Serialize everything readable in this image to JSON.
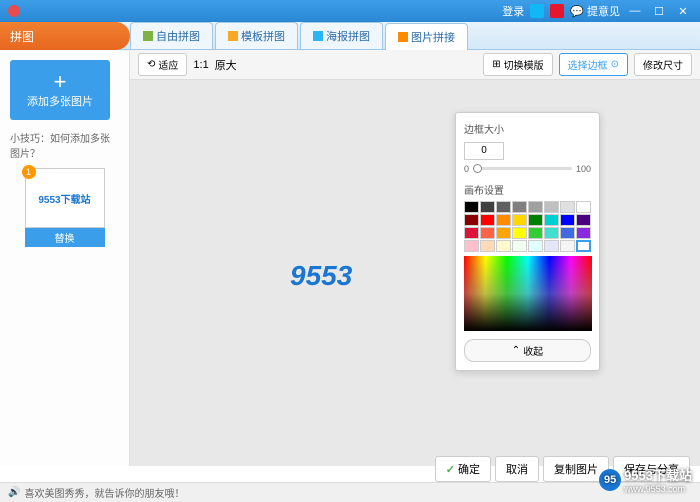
{
  "titlebar": {
    "login": "登录",
    "feedback": "提意见"
  },
  "sidebar_title": "拼图",
  "tabs": [
    {
      "label": "自由拼图"
    },
    {
      "label": "模板拼图"
    },
    {
      "label": "海报拼图"
    },
    {
      "label": "图片拼接"
    }
  ],
  "sidebar": {
    "add_label": "添加多张图片",
    "tip": "小技巧：如何添加多张图片？",
    "thumb_badge": "1",
    "thumb_text": "9553下载站",
    "replace": "替换"
  },
  "toolbar": {
    "fit": "适应",
    "ratio": "1:1",
    "original": "原大",
    "switch_template": "切换模版",
    "select_border": "选择边框",
    "modify_size": "修改尺寸"
  },
  "preview_text": "9553",
  "border_panel": {
    "size_label": "边框大小",
    "size_value": "0",
    "slider_min": "0",
    "slider_max": "100",
    "canvas_label": "画布设置",
    "collapse": "收起",
    "swatch_rows": [
      [
        "#000000",
        "#404040",
        "#606060",
        "#808080",
        "#a0a0a0",
        "#c0c0c0",
        "#e0e0e0",
        "#ffffff"
      ],
      [
        "#8b0000",
        "#ff0000",
        "#ff8c00",
        "#ffd700",
        "#008000",
        "#00ced1",
        "#0000ff",
        "#4b0082"
      ],
      [
        "#dc143c",
        "#ff6347",
        "#ffa500",
        "#ffff00",
        "#32cd32",
        "#40e0d0",
        "#4169e1",
        "#8a2be2"
      ],
      [
        "#ffc0cb",
        "#ffdab9",
        "#fffacd",
        "#f0fff0",
        "#e0ffff",
        "#e6e6fa",
        "#f5f5f5",
        "#ffffff"
      ]
    ]
  },
  "bottom": {
    "ok": "确定",
    "cancel": "取消",
    "copy": "复制图片",
    "save": "保存与分享"
  },
  "statusbar": "喜欢美图秀秀，就告诉你的朋友哦！",
  "watermark": {
    "brand": "9553下载站",
    "url": "www.9553.com"
  }
}
